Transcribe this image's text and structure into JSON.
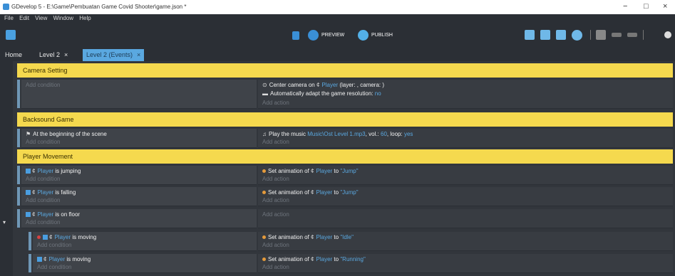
{
  "window": {
    "title": "GDevelop 5 - E:\\Game\\Pembuatan Game Covid Shooter\\game.json *",
    "minimize": "−",
    "maximize": "□",
    "close": "×"
  },
  "menu": [
    "File",
    "Edit",
    "View",
    "Window",
    "Help"
  ],
  "toolbar": {
    "preview_label": "PREVIEW",
    "publish_label": "PUBLISH"
  },
  "tabs": [
    {
      "label": "Home"
    },
    {
      "label": "Level 2",
      "close": "×"
    },
    {
      "label": "Level 2 (Events)",
      "close": "×"
    }
  ],
  "events": {
    "camera": {
      "group": "Camera Setting",
      "cond_placeholder": "Add condition",
      "action1_a": "Center camera on",
      "action1_obj": "Player",
      "action1_b": "(layer: , camera: )",
      "action2": "Automatically adapt the game resolution:",
      "action2_val": "no",
      "action_placeholder": "Add action"
    },
    "backsound": {
      "group": "Backsound Game",
      "cond": "At the beginning of the scene",
      "cond_placeholder": "Add condition",
      "action_a": "Play the music",
      "action_file": "Music\\Ost Level 1.mp3",
      "action_vol_label": ", vol.:",
      "action_vol": "60",
      "action_loop_label": ", loop:",
      "action_loop": "yes",
      "action_placeholder": "Add action"
    },
    "player": {
      "group": "Player Movement",
      "player_word": "Player",
      "set_anim": "Set animation of",
      "to": "to",
      "add_condition": "Add condition",
      "add_action": "Add action",
      "rows": [
        {
          "cond": "is jumping",
          "anim": "\"Jump\""
        },
        {
          "cond": "is falling",
          "anim": "\"Jump\""
        },
        {
          "cond": "is on floor"
        },
        {
          "cond": "is moving",
          "anim": "\"Idle\""
        },
        {
          "cond": "is moving",
          "anim": "\"Running\""
        }
      ]
    }
  }
}
